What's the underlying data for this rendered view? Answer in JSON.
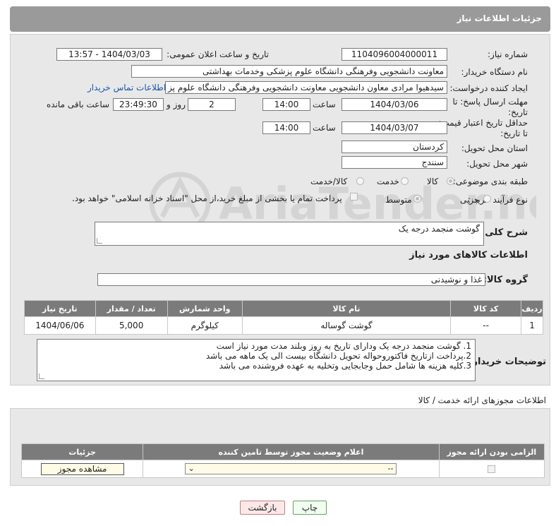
{
  "header": {
    "title": "جزئیات اطلاعات نیاز"
  },
  "form": {
    "need_number_label": "شماره نیاز:",
    "need_number": "1104096004000011",
    "announce_label": "تاریخ و ساعت اعلان عمومی:",
    "announce_value": "1404/03/03 - 13:57",
    "buyer_org_label": "نام دستگاه خریدار:",
    "buyer_org": "معاونت دانشجویی وفرهنگی دانشگاه علوم پزشکی وخدمات بهداشتی",
    "creator_label": "ایجاد کننده درخواست:",
    "creator": "سیدهیوا مرادی معاون دانشجویی معاونت دانشجویی وفرهنگی دانشگاه علوم پز",
    "contact_link": "اطلاعات تماس خریدار",
    "reply_deadline_label_1": "مهلت ارسال پاسخ: تا",
    "reply_deadline_label_2": "تاریخ:",
    "reply_date": "1404/03/06",
    "time_label": "ساعت",
    "reply_time": "14:00",
    "days_value": "2",
    "days_label": "روز و",
    "remaining_time": "23:49:30",
    "remaining_label": "ساعت باقی مانده",
    "price_validity_label_1": "حداقل تاریخ اعتبار قیمت:",
    "price_validity_label_2": "تا تاریخ:",
    "price_date": "1404/03/07",
    "price_time": "14:00",
    "province_label": "استان محل تحویل:",
    "province": "کردستان",
    "city_label": "شهر محل تحویل:",
    "city": "سنندج",
    "category_label": "طبقه بندی موضوعی:",
    "category_options": [
      "کالا",
      "خدمت",
      "کالا/خدمت"
    ],
    "category_selected": "کالا",
    "process_label": "نوع فرآیند خرید :",
    "process_options": [
      "جزیی",
      "متوسط"
    ],
    "process_selected": "متوسط",
    "payment_note": "پرداخت تمام یا بخشی از مبلغ خرید،از محل \"اسناد خزانه اسلامی\" خواهد بود."
  },
  "summary": {
    "label": "شرح کلی نیاز:",
    "value": "گوشت منجمد درجه یک"
  },
  "goods_section": {
    "title": "اطلاعات کالاهای مورد نیاز",
    "group_label": "گروه کالا:",
    "group_value": "غذا و نوشیدنی",
    "table": {
      "headers": [
        "ردیف",
        "کد کالا",
        "نام کالا",
        "واحد شمارش",
        "تعداد / مقدار",
        "تاریخ نیاز"
      ],
      "rows": [
        [
          "1",
          "--",
          "گوشت گوساله",
          "کیلوگرم",
          "5,000",
          "1404/06/06"
        ]
      ]
    }
  },
  "buyer_notes": {
    "label": "توضیحات خریدار:",
    "lines": [
      "1. گوشت منجمد درجه یک ودارای تاریخ به روز وبلند مدت مورد نیاز است",
      "2.پرداخت ازتاریخ فاکتوروحواله تحویل دانشگاه بیست الی یک ماهه می باشد",
      "3.کلیه هزینه ها شامل حمل وجابجایی وتخلیه به عهده فروشنده می باشد"
    ]
  },
  "license_section": {
    "title": "اطلاعات مجوزهای ارائه خدمت / کالا",
    "headers": [
      "الزامی بودن ارائه مجوز",
      "اعلام وضعیت مجوز توسط تامین کننده",
      "جزئیات"
    ],
    "select_value": "--",
    "view_button": "مشاهده مجوز"
  },
  "footer": {
    "print_button": "چاپ",
    "back_button": "بازگشت"
  },
  "watermark_text": "AriaTender.neT"
}
